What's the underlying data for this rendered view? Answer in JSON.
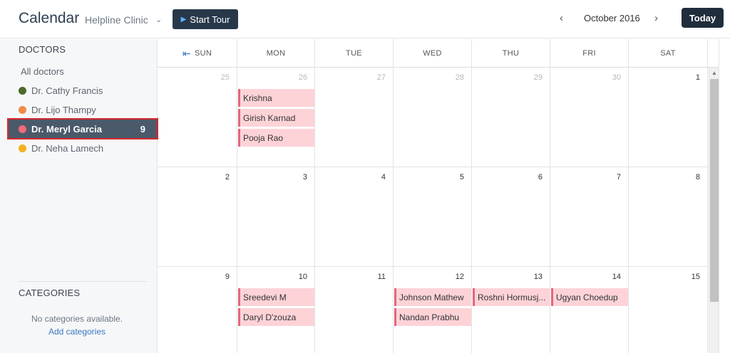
{
  "header": {
    "title": "Calendar",
    "clinic": "Helpline Clinic",
    "tour_label": "Start Tour",
    "month": "October 2016",
    "today_label": "Today"
  },
  "sidebar": {
    "doctors_title": "DOCTORS",
    "all_doctors": "All doctors",
    "doctors": [
      {
        "name": "Dr. Cathy Francis",
        "color": "#4a6a2a"
      },
      {
        "name": "Dr. Lijo Thampy",
        "color": "#f08a4b"
      },
      {
        "name": "Dr. Meryl Garcia",
        "color": "#f06a7a",
        "count": "9",
        "selected": true
      },
      {
        "name": "Dr. Neha Lamech",
        "color": "#f6b01c"
      }
    ],
    "categories_title": "CATEGORIES",
    "no_categories": "No categories available.",
    "add_categories": "Add categories"
  },
  "calendar": {
    "weekdays": [
      "SUN",
      "MON",
      "TUE",
      "WED",
      "THU",
      "FRI",
      "SAT"
    ],
    "weeks": [
      [
        {
          "d": "25",
          "other": true
        },
        {
          "d": "26",
          "other": true
        },
        {
          "d": "27",
          "other": true
        },
        {
          "d": "28",
          "other": true
        },
        {
          "d": "29",
          "other": true
        },
        {
          "d": "30",
          "other": true
        },
        {
          "d": "1"
        }
      ],
      [
        {
          "d": "2"
        },
        {
          "d": "3"
        },
        {
          "d": "4"
        },
        {
          "d": "5"
        },
        {
          "d": "6"
        },
        {
          "d": "7"
        },
        {
          "d": "8"
        }
      ],
      [
        {
          "d": "9"
        },
        {
          "d": "10"
        },
        {
          "d": "11"
        },
        {
          "d": "12"
        },
        {
          "d": "13"
        },
        {
          "d": "14"
        },
        {
          "d": "15"
        }
      ]
    ],
    "events": [
      {
        "week": 0,
        "day": 1,
        "slot": 0,
        "title": "Krishna"
      },
      {
        "week": 0,
        "day": 1,
        "slot": 1,
        "title": "Girish Karnad"
      },
      {
        "week": 0,
        "day": 1,
        "slot": 2,
        "title": "Pooja Rao"
      },
      {
        "week": 2,
        "day": 1,
        "slot": 0,
        "title": "Sreedevi M"
      },
      {
        "week": 2,
        "day": 1,
        "slot": 1,
        "title": "Daryl D'zouza"
      },
      {
        "week": 2,
        "day": 3,
        "slot": 0,
        "title": "Johnson Mathew"
      },
      {
        "week": 2,
        "day": 3,
        "slot": 1,
        "title": "Nandan Prabhu"
      },
      {
        "week": 2,
        "day": 4,
        "slot": 0,
        "title": "Roshni Hormusj..."
      },
      {
        "week": 2,
        "day": 5,
        "slot": 0,
        "title": "Ugyan Choedup"
      }
    ]
  }
}
